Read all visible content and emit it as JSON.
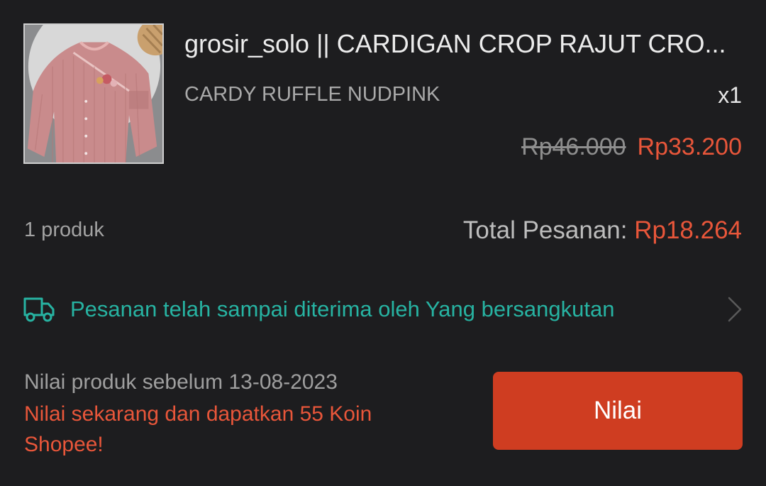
{
  "order_item": {
    "product_image": "pink-knit-cardigan-photo",
    "title": "grosir_solo || CARDIGAN CROP RAJUT CRO...",
    "variant": "CARDY RUFFLE NUDPINK",
    "quantity": "x1",
    "price_original": "Rp46.000",
    "price_discounted": "Rp33.200"
  },
  "summary": {
    "product_count": "1 produk",
    "total_label": "Total Pesanan: ",
    "total_value": "Rp18.264"
  },
  "shipping": {
    "icon": "truck-icon",
    "status": "Pesanan telah sampai diterima oleh Yang bersangkutan"
  },
  "rating": {
    "deadline": "Nilai produk sebelum 13-08-2023",
    "promo": "Nilai sekarang dan dapatkan 55 Koin Shopee!",
    "button_label": "Nilai"
  },
  "colors": {
    "background": "#1d1d1f",
    "accent": "#e8563a",
    "button": "#cf3d21",
    "status_teal": "#27b3a2"
  }
}
